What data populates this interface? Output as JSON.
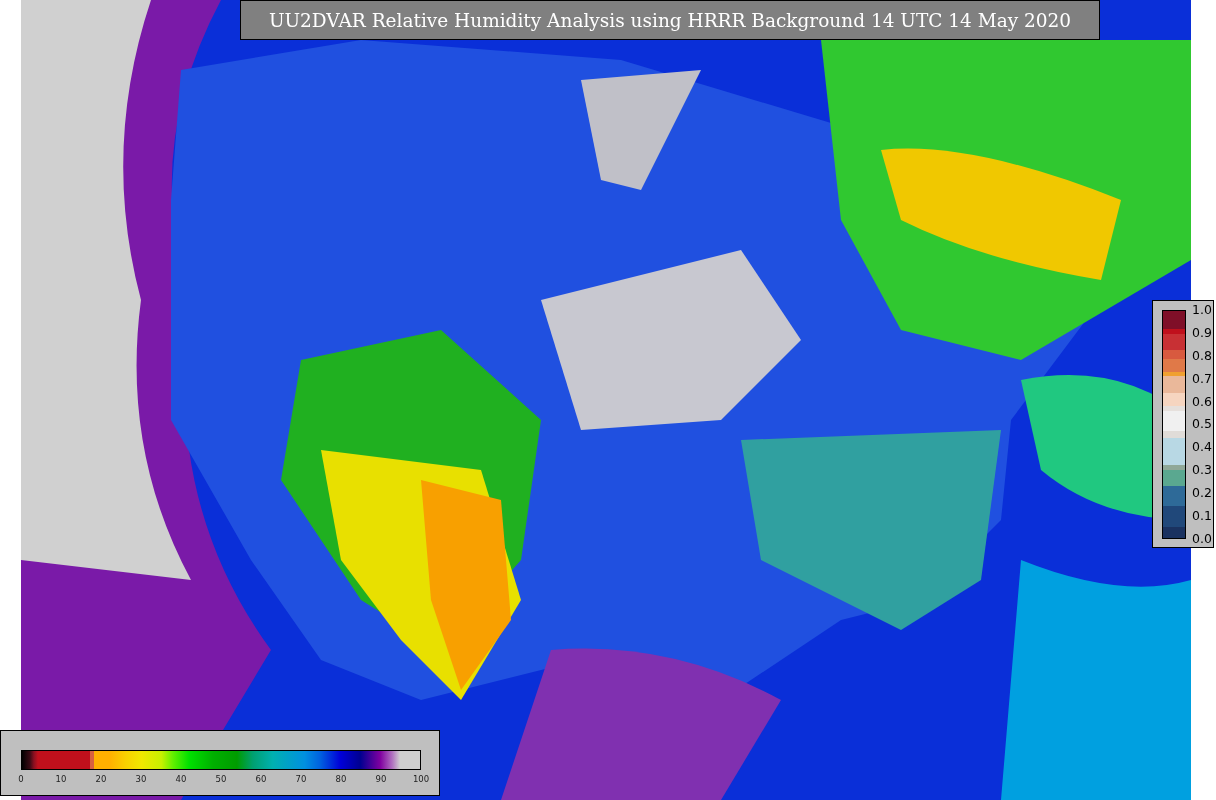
{
  "title": "UU2DVAR Relative Humidity Analysis using HRRR Background 14 UTC 14 May 2020",
  "colorbars": [
    {
      "kind": "vertical",
      "ticks": [
        "1.0",
        "0.9",
        "0.8",
        "0.7",
        "0.6",
        "0.5",
        "0.4",
        "0.3",
        "0.2",
        "0.1",
        "0.0"
      ]
    },
    {
      "kind": "horizontal",
      "ticks": [
        "0",
        "10",
        "20",
        "30",
        "40",
        "50",
        "60",
        "70",
        "80",
        "90",
        "100"
      ]
    }
  ]
}
